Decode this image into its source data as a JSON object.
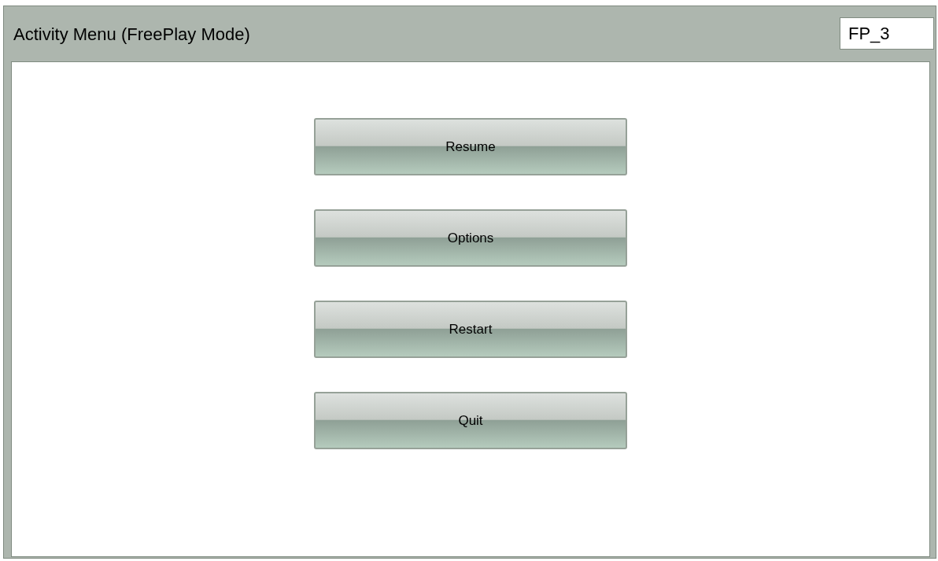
{
  "window": {
    "title": "Activity Menu (FreePlay Mode)",
    "screen_id": "FP_3"
  },
  "buttons": [
    "Resume",
    "Options",
    "Restart",
    "Quit"
  ]
}
